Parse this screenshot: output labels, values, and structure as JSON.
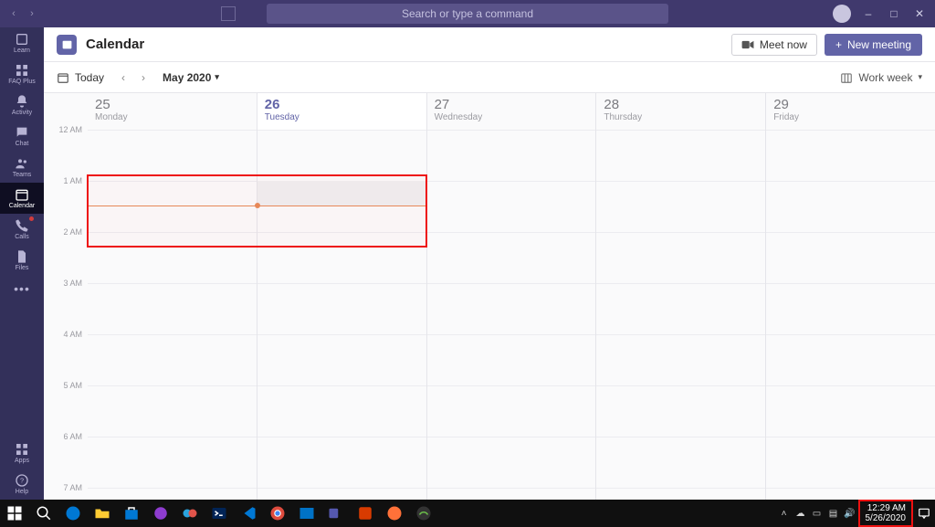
{
  "searchbar": {
    "placeholder": "Search or type a command"
  },
  "leftrail": {
    "items": [
      {
        "id": "learn",
        "label": "Learn"
      },
      {
        "id": "faqplus",
        "label": "FAQ Plus"
      },
      {
        "id": "activity",
        "label": "Activity"
      },
      {
        "id": "chat",
        "label": "Chat"
      },
      {
        "id": "teams",
        "label": "Teams"
      },
      {
        "id": "calendar",
        "label": "Calendar"
      },
      {
        "id": "calls",
        "label": "Calls"
      },
      {
        "id": "files",
        "label": "Files"
      }
    ],
    "apps_label": "Apps",
    "help_label": "Help"
  },
  "header": {
    "title": "Calendar",
    "meet_now": "Meet now",
    "new_meeting": "New meeting"
  },
  "toolbar": {
    "today": "Today",
    "month": "May 2020",
    "view": "Work week"
  },
  "days": [
    {
      "num": "25",
      "name": "Monday"
    },
    {
      "num": "26",
      "name": "Tuesday"
    },
    {
      "num": "27",
      "name": "Wednesday"
    },
    {
      "num": "28",
      "name": "Thursday"
    },
    {
      "num": "29",
      "name": "Friday"
    }
  ],
  "hours": [
    "12 AM",
    "1 AM",
    "2 AM",
    "3 AM",
    "4 AM",
    "5 AM",
    "6 AM",
    "7 AM"
  ],
  "clock": {
    "time": "12:29 AM",
    "date": "5/26/2020"
  }
}
